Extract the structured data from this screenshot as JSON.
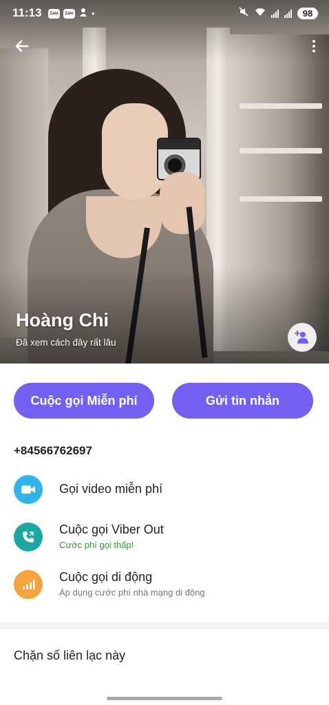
{
  "status_bar": {
    "time": "11:13",
    "app_badges": [
      "Zalo",
      "Zalo"
    ],
    "battery": "98"
  },
  "profile": {
    "name": "Hoàng Chi",
    "last_seen": "Đã xem cách đây rất lâu"
  },
  "actions": {
    "free_call": "Cuộc gọi Miễn phí",
    "send_message": "Gửi tin nhắn"
  },
  "phone_number": "+84566762697",
  "options": [
    {
      "title": "Gọi video miễn phí",
      "subtitle": "",
      "icon": "video-icon",
      "color": "#2fb5ea"
    },
    {
      "title": "Cuộc gọi Viber Out",
      "subtitle": "Cước phí gọi thấp!",
      "icon": "viber-out-icon",
      "color": "#1aa8a0",
      "subtitle_color": "#2aa02a"
    },
    {
      "title": "Cuộc gọi di động",
      "subtitle": "Áp dụng cước phí nhà mạng di động",
      "icon": "signal-icon",
      "color": "#f5a33a",
      "subtitle_color": "#777777"
    }
  ],
  "block_contact": "Chặn số liên lạc này",
  "colors": {
    "accent": "#7360f2"
  }
}
